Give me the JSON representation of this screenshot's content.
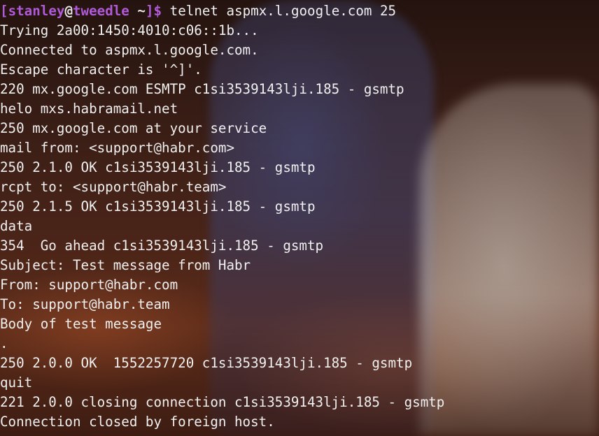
{
  "prompt": {
    "open_bracket": "[",
    "user": "stanley",
    "at": "@",
    "host": "tweedle",
    "path": " ~",
    "close_bracket": "]",
    "dollar": "$",
    "command": " telnet aspmx.l.google.com 25"
  },
  "output_lines": [
    "Trying 2a00:1450:4010:c06::1b...",
    "Connected to aspmx.l.google.com.",
    "Escape character is '^]'.",
    "220 mx.google.com ESMTP c1si3539143lji.185 - gsmtp",
    "helo mxs.habramail.net",
    "250 mx.google.com at your service",
    "mail from: <support@habr.com>",
    "250 2.1.0 OK c1si3539143lji.185 - gsmtp",
    "rcpt to: <support@habr.team>",
    "250 2.1.5 OK c1si3539143lji.185 - gsmtp",
    "data",
    "354  Go ahead c1si3539143lji.185 - gsmtp",
    "Subject: Test message from Habr",
    "From: support@habr.com",
    "To: support@habr.team",
    "Body of test message",
    ".",
    "250 2.0.0 OK  1552257720 c1si3539143lji.185 - gsmtp",
    "quit",
    "221 2.0.0 closing connection c1si3539143lji.185 - gsmtp",
    "Connection closed by foreign host."
  ],
  "colors": {
    "prompt_accent": "#b05ad8",
    "text": "#f0f0f0"
  }
}
